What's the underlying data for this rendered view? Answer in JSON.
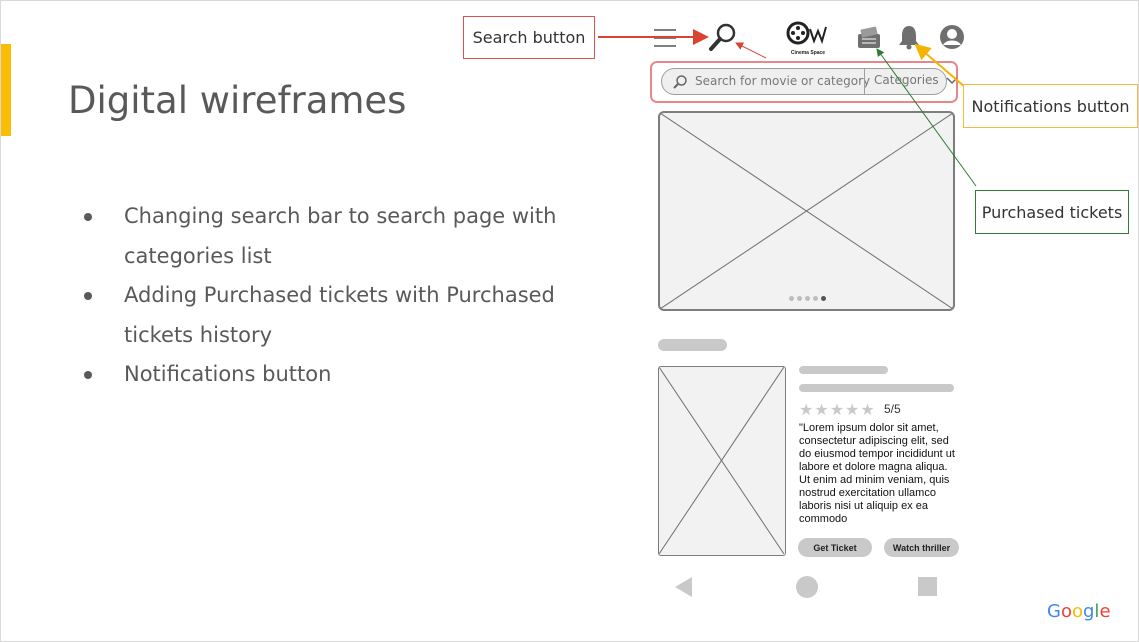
{
  "slide": {
    "title": "Digital wireframes",
    "bullets": [
      "Changing search bar to search page with categories list",
      "Adding Purchased tickets with Purchased tickets history",
      "Notifications button"
    ]
  },
  "callouts": {
    "search": "Search button",
    "notifications": "Notifications button",
    "purchased": "Purchased tickets"
  },
  "wireframe": {
    "logo_text": "Cinema Space",
    "search_placeholder": "Search for movie or category",
    "categories_label": "Categories",
    "carousel_dots": 5,
    "carousel_active": 5,
    "movie": {
      "stars_filled": 0,
      "stars_total": 5,
      "rating_text": "5/5",
      "description": "\"Lorem ipsum dolor sit amet, consectetur adipiscing elit, sed do eiusmod tempor incididunt ut labore et dolore magna aliqua. Ut enim ad minim veniam, quis nostrud exercitation ullamco laboris nisi ut aliquip ex ea commodo"
    },
    "buttons": {
      "get_ticket": "Get Ticket",
      "watch_trailer": "Watch thriller"
    }
  },
  "brand": {
    "google_letters": [
      "G",
      "o",
      "o",
      "g",
      "l",
      "e"
    ],
    "google_colors": [
      "#4285F4",
      "#EA4335",
      "#FBBC05",
      "#4285F4",
      "#34A853",
      "#EA4335"
    ]
  },
  "colors": {
    "accent": "#fbbc04",
    "search_arrow": "#d9432f",
    "notif_arrow": "#f5b400",
    "tickets_arrow": "#2e7d32"
  }
}
